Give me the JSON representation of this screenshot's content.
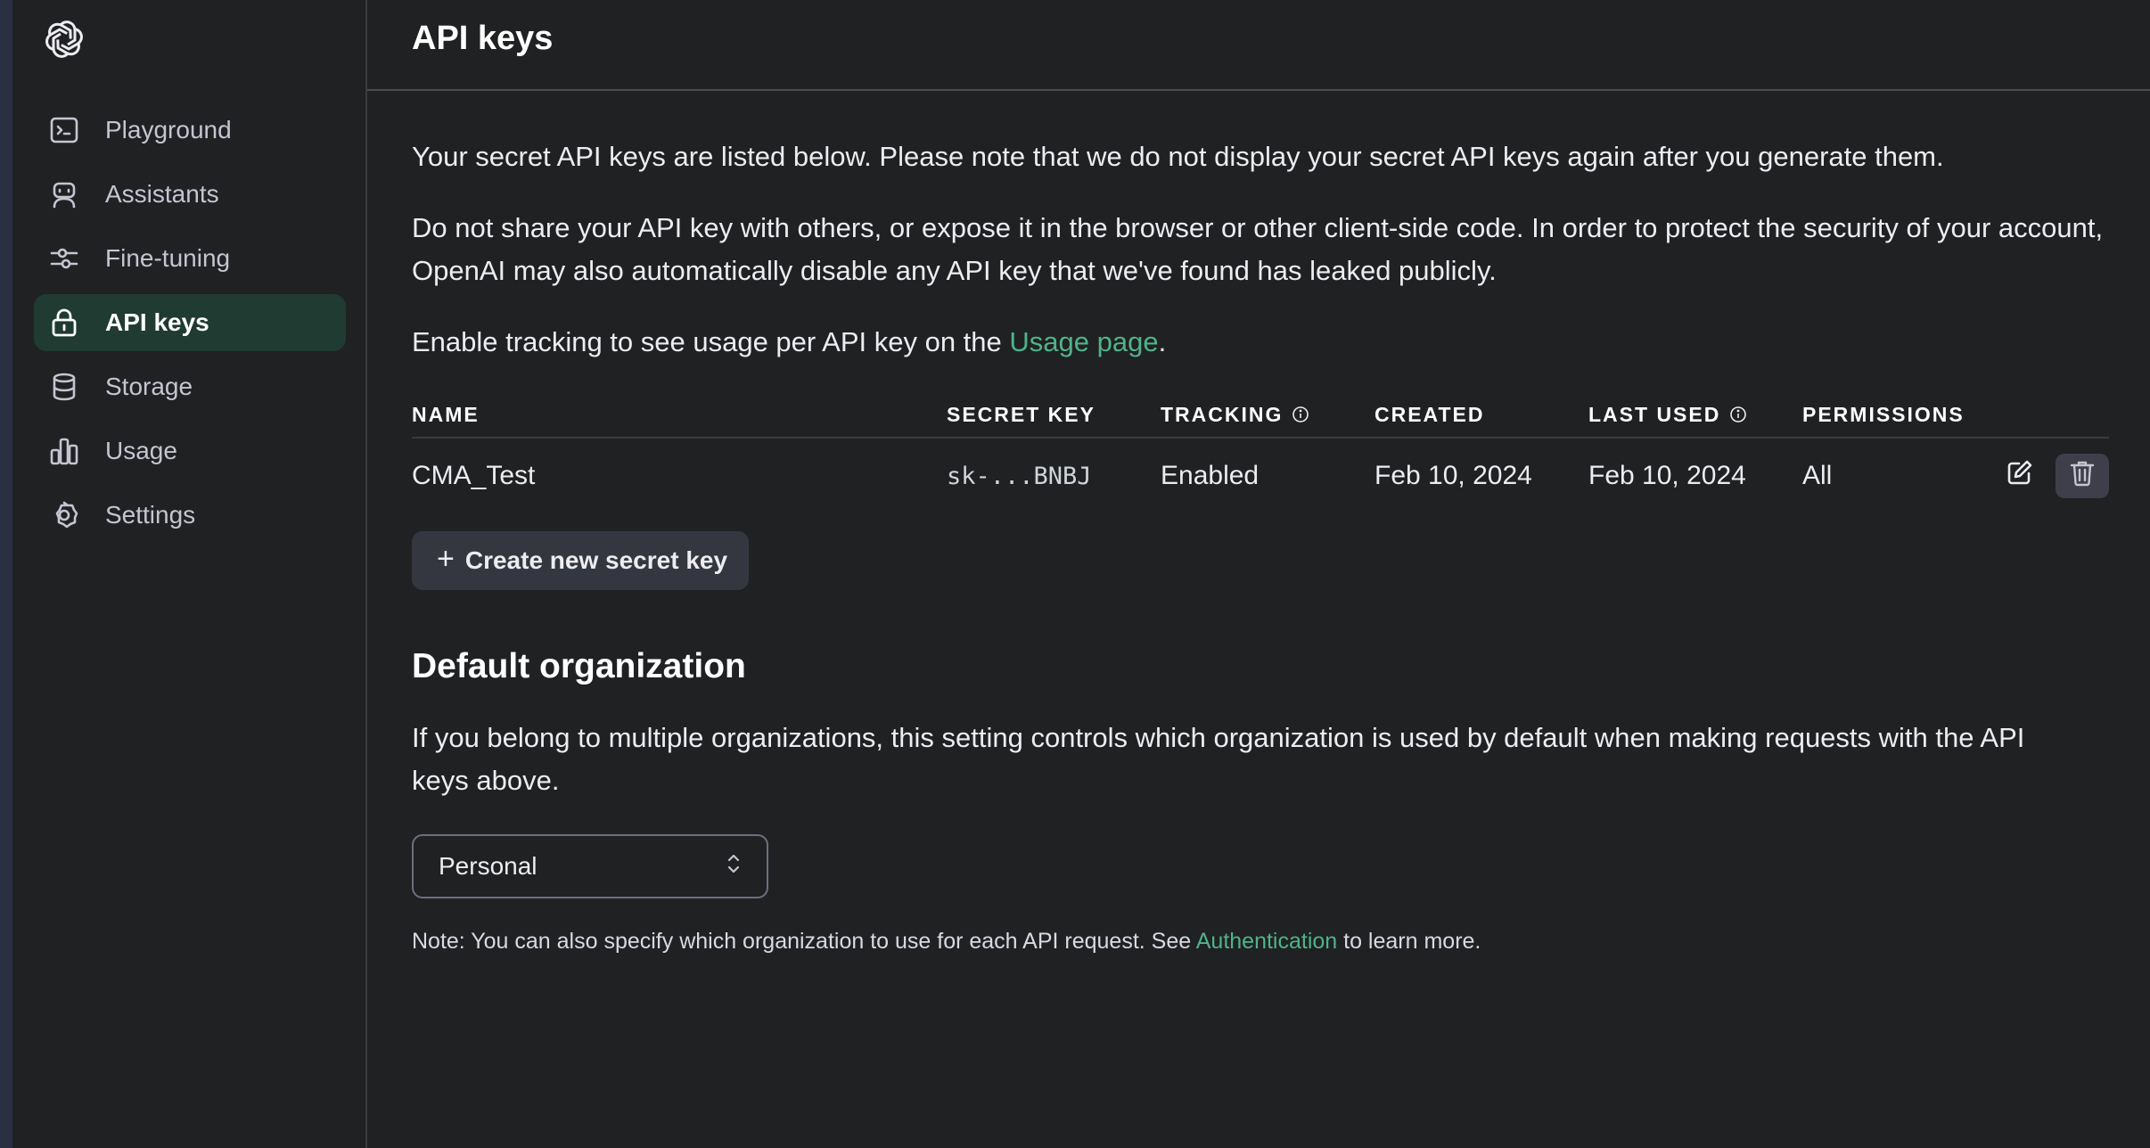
{
  "sidebar": {
    "logo": "openai-logo",
    "items": [
      {
        "label": "Playground",
        "icon": "terminal-icon"
      },
      {
        "label": "Assistants",
        "icon": "robot-icon"
      },
      {
        "label": "Fine-tuning",
        "icon": "sliders-icon"
      },
      {
        "label": "API keys",
        "icon": "lock-icon",
        "active": true
      },
      {
        "label": "Storage",
        "icon": "database-icon"
      },
      {
        "label": "Usage",
        "icon": "bar-chart-icon"
      },
      {
        "label": "Settings",
        "icon": "gear-icon"
      }
    ]
  },
  "header": {
    "title": "API keys"
  },
  "intro": {
    "p1": "Your secret API keys are listed below. Please note that we do not display your secret API keys again after you generate them.",
    "p2": "Do not share your API key with others, or expose it in the browser or other client-side code. In order to protect the security of your account, OpenAI may also automatically disable any API key that we've found has leaked publicly.",
    "p3_prefix": "Enable tracking to see usage per API key on the ",
    "p3_link": "Usage page",
    "p3_suffix": "."
  },
  "table": {
    "columns": {
      "name": "NAME",
      "secret_key": "SECRET KEY",
      "tracking": "TRACKING",
      "created": "CREATED",
      "last_used": "LAST USED",
      "permissions": "PERMISSIONS"
    },
    "rows": [
      {
        "name": "CMA_Test",
        "secret_key": "sk-...BNBJ",
        "tracking": "Enabled",
        "created": "Feb 10, 2024",
        "last_used": "Feb 10, 2024",
        "permissions": "All"
      }
    ]
  },
  "create_button": {
    "label": "Create new secret key"
  },
  "default_org": {
    "title": "Default organization",
    "description": "If you belong to multiple organizations, this setting controls which organization is used by default when making requests with the API keys above.",
    "selected": "Personal",
    "note_prefix": "Note: You can also specify which organization to use for each API request. See ",
    "note_link": "Authentication",
    "note_suffix": " to learn more."
  },
  "colors": {
    "background": "#202123",
    "accent": "#4fb38a",
    "active_nav_bg": "#203b31"
  }
}
